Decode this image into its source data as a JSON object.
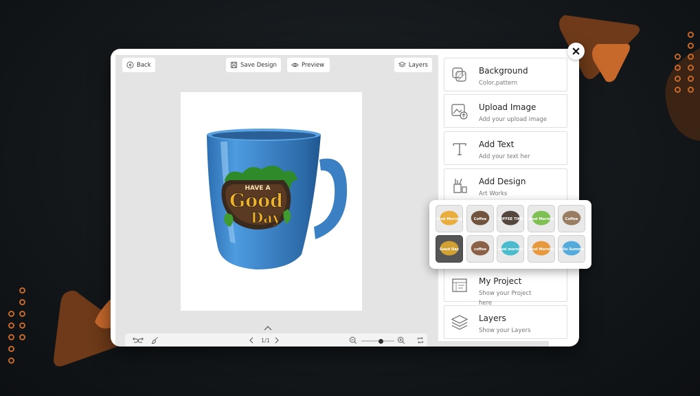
{
  "toolbar": {
    "back_label": "Back",
    "save_label": "Save Design",
    "preview_label": "Preview",
    "layers_label": "Layers"
  },
  "sticker": {
    "line1": "HAVE A",
    "line2": "Good",
    "line3": "Day"
  },
  "page_indicator": "1/1",
  "zoom_level": 0.6,
  "sidebar": {
    "items": [
      {
        "title": "Background",
        "sub": "Color,pattern",
        "icon": "background-icon"
      },
      {
        "title": "Upload Image",
        "sub": "Add your upload image",
        "icon": "upload-image-icon"
      },
      {
        "title": "Add Text",
        "sub": "Add your text her",
        "icon": "text-icon"
      },
      {
        "title": "Add Design",
        "sub": "Art Works",
        "icon": "design-icon"
      },
      {
        "title": "My Project",
        "sub": "Show your Project here",
        "icon": "project-icon"
      },
      {
        "title": "Layers",
        "sub": "Show your Layers",
        "icon": "layers-icon"
      }
    ]
  },
  "designs": [
    {
      "text": "Good Morning",
      "color": "#e8a21e",
      "selected": false
    },
    {
      "text": "Coffee",
      "color": "#5a3a22",
      "selected": false
    },
    {
      "text": "COFFEE TIME",
      "color": "#3b2a1e",
      "selected": false
    },
    {
      "text": "Good Morning",
      "color": "#6bb83a",
      "selected": false
    },
    {
      "text": "Coffee",
      "color": "#8a6a4a",
      "selected": false
    },
    {
      "text": "Good Day",
      "color": "#e8b02c",
      "selected": true
    },
    {
      "text": "coffee",
      "color": "#7a4a2a",
      "selected": false
    },
    {
      "text": "Good morning",
      "color": "#2fb3c9",
      "selected": false
    },
    {
      "text": "Good Morning",
      "color": "#e88a1e",
      "selected": false
    },
    {
      "text": "Hello Summer",
      "color": "#3aa0d8",
      "selected": false
    }
  ],
  "colors": {
    "accent": "#c8692c",
    "mug": "#3f86c9"
  }
}
